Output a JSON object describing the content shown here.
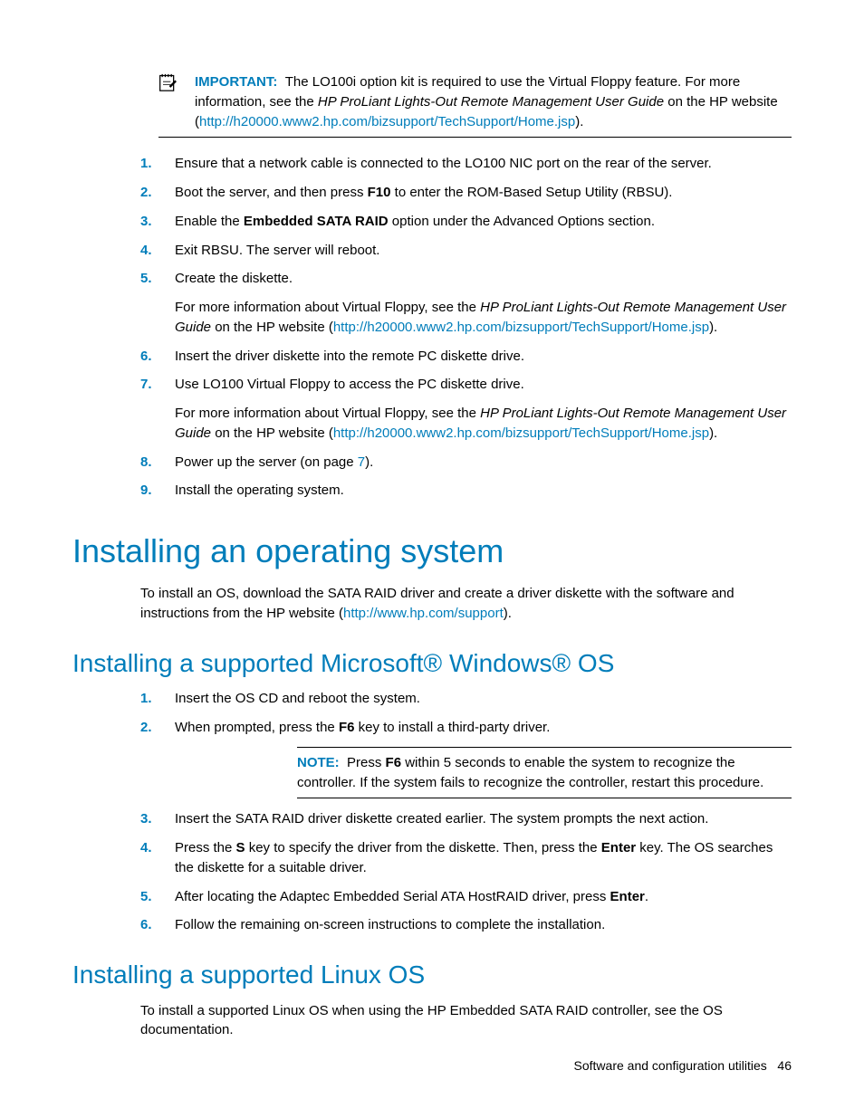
{
  "importantBox": {
    "label": "IMPORTANT:",
    "text1": "The LO100i option kit is required to use the Virtual Floppy feature. For more information, see the ",
    "docTitle": "HP ProLiant Lights-Out Remote Management User Guide",
    "text2": " on the HP website (",
    "link": "http://h20000.www2.hp.com/bizsupport/TechSupport/Home.jsp",
    "text3": ")."
  },
  "stepsA": {
    "s1": {
      "n": "1.",
      "t": "Ensure that a network cable is connected to the LO100 NIC port on the rear of the server."
    },
    "s2": {
      "n": "2.",
      "pre": "Boot the server, and then press ",
      "bold": "F10",
      "post": " to enter the ROM-Based Setup Utility (RBSU)."
    },
    "s3": {
      "n": "3.",
      "pre": "Enable the ",
      "bold": "Embedded SATA RAID",
      "post": " option under the Advanced Options section."
    },
    "s4": {
      "n": "4.",
      "t": "Exit RBSU. The server will reboot."
    },
    "s5": {
      "n": "5.",
      "t": "Create the diskette.",
      "para_pre": "For more information about Virtual Floppy, see the ",
      "para_doc": "HP ProLiant Lights-Out Remote Management User Guide",
      "para_mid": " on the HP website (",
      "para_link": "http://h20000.www2.hp.com/bizsupport/TechSupport/Home.jsp",
      "para_post": ")."
    },
    "s6": {
      "n": "6.",
      "t": "Insert the driver diskette into the remote PC diskette drive."
    },
    "s7": {
      "n": "7.",
      "t": "Use LO100 Virtual Floppy to access the PC diskette drive.",
      "para_pre": "For more information about Virtual Floppy, see the ",
      "para_doc": "HP ProLiant Lights-Out Remote Management User Guide",
      "para_mid": " on the HP website (",
      "para_link": "http://h20000.www2.hp.com/bizsupport/TechSupport/Home.jsp",
      "para_post": ")."
    },
    "s8": {
      "n": "8.",
      "pre": "Power up the server (on page ",
      "link": "7",
      "post": ")."
    },
    "s9": {
      "n": "9.",
      "t": "Install the operating system."
    }
  },
  "h1": "Installing an operating system",
  "osIntro": {
    "pre": "To install an OS, download the SATA RAID driver and create a driver diskette with the software and instructions from the HP website (",
    "link": "http://www.hp.com/support",
    "post": ")."
  },
  "h2a": "Installing a supported Microsoft® Windows® OS",
  "stepsB": {
    "s1": {
      "n": "1.",
      "t": "Insert the OS CD and reboot the system."
    },
    "s2": {
      "n": "2.",
      "pre": "When prompted, press the ",
      "bold": "F6",
      "post": " key to install a third-party driver."
    },
    "s3": {
      "n": "3.",
      "t": "Insert the SATA RAID driver diskette created earlier. The system prompts the next action."
    },
    "s4": {
      "n": "4.",
      "pre": "Press the ",
      "bold1": "S",
      "mid": " key to specify the driver from the diskette. Then, press the ",
      "bold2": "Enter",
      "post": " key. The OS searches the diskette for a suitable driver."
    },
    "s5": {
      "n": "5.",
      "pre": "After locating the Adaptec Embedded Serial ATA HostRAID driver, press ",
      "bold": "Enter",
      "post": "."
    },
    "s6": {
      "n": "6.",
      "t": "Follow the remaining on-screen instructions to complete the installation."
    }
  },
  "noteBox": {
    "label": "NOTE:",
    "pre": "Press ",
    "bold": "F6",
    "post": " within 5 seconds to enable the system to recognize the controller. If the system fails to recognize the controller, restart this procedure."
  },
  "h2b": "Installing a supported Linux OS",
  "linuxPara": "To install a supported Linux OS when using the HP Embedded SATA RAID controller, see the OS documentation.",
  "footer": {
    "title": "Software and configuration utilities",
    "page": "46"
  }
}
